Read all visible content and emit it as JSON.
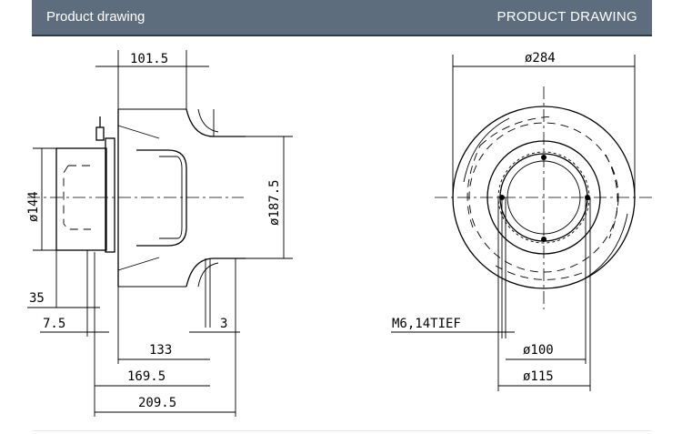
{
  "header": {
    "left_title": "Product drawing",
    "right_title": "PRODUCT DRAWING"
  },
  "side_view": {
    "dim_top": "101.5",
    "dim_left_dia": "ø144",
    "dim_right_dia": "ø187.5",
    "dim_35": "35",
    "dim_7_5": "7.5",
    "dim_3": "3",
    "dim_133": "133",
    "dim_169_5": "169.5",
    "dim_209_5": "209.5"
  },
  "front_view": {
    "dim_top": "ø284",
    "thread_note": "M6,14TIEF",
    "dim_100": "ø100",
    "dim_115": "ø115"
  }
}
